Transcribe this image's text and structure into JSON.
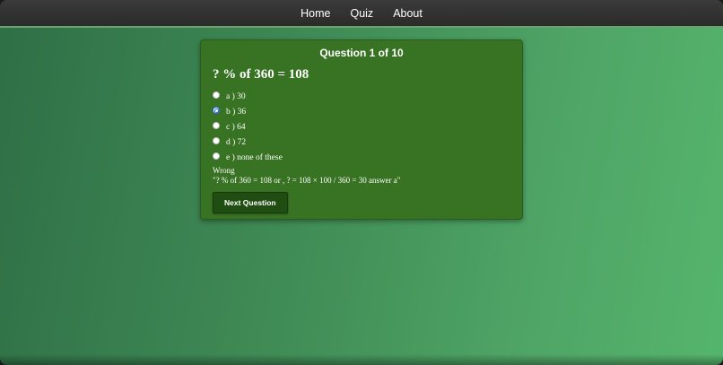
{
  "nav": {
    "items": [
      {
        "label": "Home"
      },
      {
        "label": "Quiz"
      },
      {
        "label": "About"
      }
    ]
  },
  "quiz": {
    "counter": "Question 1 of 10",
    "question": "? % of 360 = 108",
    "options": [
      {
        "label": "a ) 30",
        "selected": false
      },
      {
        "label": "b ) 36",
        "selected": true
      },
      {
        "label": "c ) 64",
        "selected": false
      },
      {
        "label": "d ) 72",
        "selected": false
      },
      {
        "label": "e ) none of these",
        "selected": false
      }
    ],
    "result_status": "Wrong",
    "explanation": "\"? % of 360 = 108 or , ? = 108 × 100 / 360 = 30 answer a\"",
    "next_button_label": "Next Question"
  },
  "colors": {
    "card_bg": "#387223",
    "button_bg": "#1f4d12",
    "navbar_bg": "#2b2b2b",
    "selected_radio": "#2d6cdf"
  }
}
